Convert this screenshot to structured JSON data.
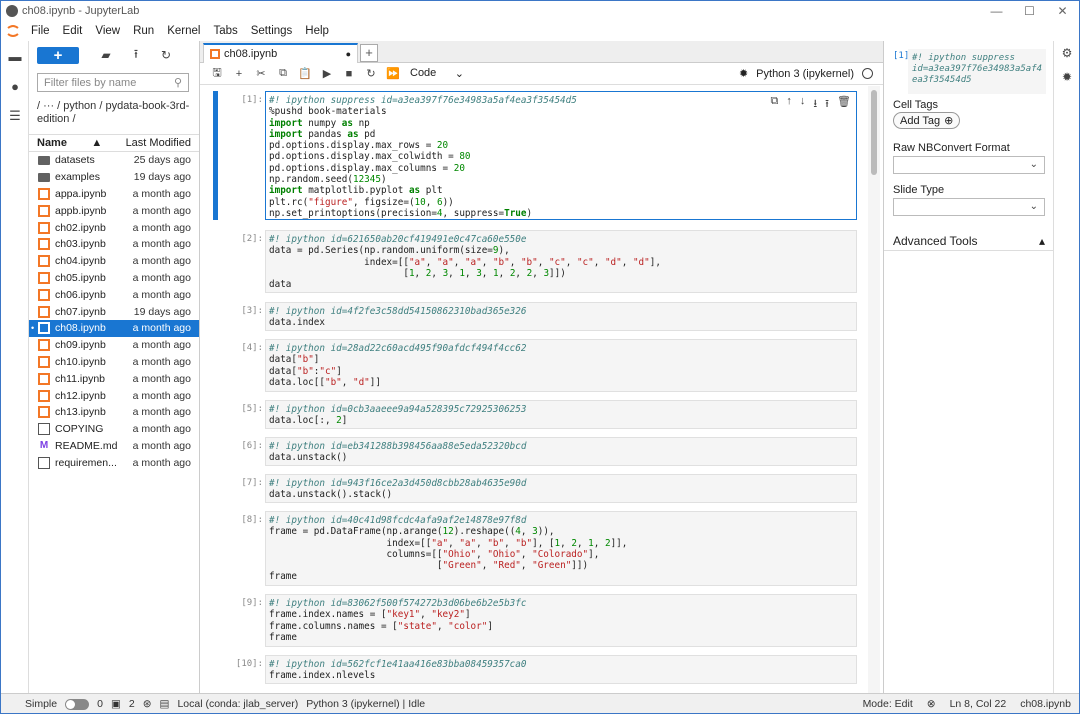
{
  "window": {
    "title": "ch08.ipynb - JupyterLab",
    "minimize": "—",
    "maximize": "☐",
    "close": "✕"
  },
  "menu": [
    "File",
    "Edit",
    "View",
    "Run",
    "Kernel",
    "Tabs",
    "Settings",
    "Help"
  ],
  "filebrowser": {
    "new_label": "+",
    "filter_placeholder": "Filter files by name",
    "breadcrumb_line1": "/ ··· / python / pydata-book-3rd-",
    "breadcrumb_line2": "edition /",
    "header_name": "Name",
    "header_modified": "Last Modified",
    "sort_arrow": "▲",
    "files": [
      {
        "name": "datasets",
        "modified": "25 days ago",
        "kind": "folder"
      },
      {
        "name": "examples",
        "modified": "19 days ago",
        "kind": "folder"
      },
      {
        "name": "appa.ipynb",
        "modified": "a month ago",
        "kind": "notebook"
      },
      {
        "name": "appb.ipynb",
        "modified": "a month ago",
        "kind": "notebook"
      },
      {
        "name": "ch02.ipynb",
        "modified": "a month ago",
        "kind": "notebook"
      },
      {
        "name": "ch03.ipynb",
        "modified": "a month ago",
        "kind": "notebook"
      },
      {
        "name": "ch04.ipynb",
        "modified": "a month ago",
        "kind": "notebook"
      },
      {
        "name": "ch05.ipynb",
        "modified": "a month ago",
        "kind": "notebook"
      },
      {
        "name": "ch06.ipynb",
        "modified": "a month ago",
        "kind": "notebook"
      },
      {
        "name": "ch07.ipynb",
        "modified": "19 days ago",
        "kind": "notebook"
      },
      {
        "name": "ch08.ipynb",
        "modified": "a month ago",
        "kind": "notebook",
        "selected": true
      },
      {
        "name": "ch09.ipynb",
        "modified": "a month ago",
        "kind": "notebook"
      },
      {
        "name": "ch10.ipynb",
        "modified": "a month ago",
        "kind": "notebook"
      },
      {
        "name": "ch11.ipynb",
        "modified": "a month ago",
        "kind": "notebook"
      },
      {
        "name": "ch12.ipynb",
        "modified": "a month ago",
        "kind": "notebook"
      },
      {
        "name": "ch13.ipynb",
        "modified": "a month ago",
        "kind": "notebook"
      },
      {
        "name": "COPYING",
        "modified": "a month ago",
        "kind": "file"
      },
      {
        "name": "README.md",
        "modified": "a month ago",
        "kind": "markdown"
      },
      {
        "name": "requiremen...",
        "modified": "a month ago",
        "kind": "file"
      }
    ]
  },
  "tab": {
    "label": "ch08.ipynb",
    "dirty": "●",
    "add": "+"
  },
  "toolbar": {
    "cell_type": "Code",
    "kernel": "Python 3 (ipykernel)"
  },
  "cells": [
    {
      "prompt": "[1]:",
      "active": true,
      "html": "<span class=\"cmt\">#! ipython suppress id=a3ea397f76e34983a5af4ea3f35454d5</span>\n%pushd book-materials\n<span class=\"kw\">import</span> numpy <span class=\"kw\">as</span> np\n<span class=\"kw\">import</span> pandas <span class=\"kw\">as</span> pd\npd.options.display.max_rows = <span class=\"num\">20</span>\npd.options.display.max_colwidth = <span class=\"num\">80</span>\npd.options.display.max_columns = <span class=\"num\">20</span>\nnp.random.seed(<span class=\"num\">12345</span>)\n<span class=\"kw\">import</span> matplotlib.pyplot <span class=\"kw\">as</span> plt\nplt.rc(<span class=\"str\">\"figure\"</span>, figsize=(<span class=\"num\">10</span>, <span class=\"num\">6</span>))\nnp.set_printoptions(precision=<span class=\"num\">4</span>, suppress=<span class=\"kw\">True</span>)"
    },
    {
      "prompt": "[2]:",
      "html": "<span class=\"cmt\">#! ipython id=621650ab20cf419491e0c47ca60e550e</span>\ndata = pd.Series(np.random.uniform(size=<span class=\"num\">9</span>),\n                 index=[[<span class=\"str\">\"a\"</span>, <span class=\"str\">\"a\"</span>, <span class=\"str\">\"a\"</span>, <span class=\"str\">\"b\"</span>, <span class=\"str\">\"b\"</span>, <span class=\"str\">\"c\"</span>, <span class=\"str\">\"c\"</span>, <span class=\"str\">\"d\"</span>, <span class=\"str\">\"d\"</span>],\n                        [<span class=\"num\">1</span>, <span class=\"num\">2</span>, <span class=\"num\">3</span>, <span class=\"num\">1</span>, <span class=\"num\">3</span>, <span class=\"num\">1</span>, <span class=\"num\">2</span>, <span class=\"num\">2</span>, <span class=\"num\">3</span>]])\ndata"
    },
    {
      "prompt": "[3]:",
      "html": "<span class=\"cmt\">#! ipython id=4f2fe3c58dd54150862310bad365e326</span>\ndata.index"
    },
    {
      "prompt": "[4]:",
      "html": "<span class=\"cmt\">#! ipython id=28ad22c60acd495f90afdcf494f4cc62</span>\ndata[<span class=\"str\">\"b\"</span>]\ndata[<span class=\"str\">\"b\"</span>:<span class=\"str\">\"c\"</span>]\ndata.loc[[<span class=\"str\">\"b\"</span>, <span class=\"str\">\"d\"</span>]]"
    },
    {
      "prompt": "[5]:",
      "html": "<span class=\"cmt\">#! ipython id=0cb3aaeee9a94a528395c72925306253</span>\ndata.loc[:, <span class=\"num\">2</span>]"
    },
    {
      "prompt": "[6]:",
      "html": "<span class=\"cmt\">#! ipython id=eb341288b398456aa88e5eda52320bcd</span>\ndata.unstack()"
    },
    {
      "prompt": "[7]:",
      "html": "<span class=\"cmt\">#! ipython id=943f16ce2a3d450d8cbb28ab4635e90d</span>\ndata.unstack().stack()"
    },
    {
      "prompt": "[8]:",
      "html": "<span class=\"cmt\">#! ipython id=40c41d98fcdc4afa9af2e14878e97f8d</span>\nframe = pd.DataFrame(np.arange(<span class=\"num\">12</span>).reshape((<span class=\"num\">4</span>, <span class=\"num\">3</span>)),\n                     index=[[<span class=\"str\">\"a\"</span>, <span class=\"str\">\"a\"</span>, <span class=\"str\">\"b\"</span>, <span class=\"str\">\"b\"</span>], [<span class=\"num\">1</span>, <span class=\"num\">2</span>, <span class=\"num\">1</span>, <span class=\"num\">2</span>]],\n                     columns=[[<span class=\"str\">\"Ohio\"</span>, <span class=\"str\">\"Ohio\"</span>, <span class=\"str\">\"Colorado\"</span>],\n                              [<span class=\"str\">\"Green\"</span>, <span class=\"str\">\"Red\"</span>, <span class=\"str\">\"Green\"</span>]])\nframe"
    },
    {
      "prompt": "[9]:",
      "html": "<span class=\"cmt\">#! ipython id=83062f500f574272b3d06be6b2e5b3fc</span>\nframe.index.names = [<span class=\"str\">\"key1\"</span>, <span class=\"str\">\"key2\"</span>]\nframe.columns.names = [<span class=\"str\">\"state\"</span>, <span class=\"str\">\"color\"</span>]\nframe"
    },
    {
      "prompt": "[10]:",
      "html": "<span class=\"cmt\">#! ipython id=562fcf1e41aa416e83bba08459357ca0</span>\nframe.index.nlevels"
    }
  ],
  "rightpanel": {
    "prompt": "[1]:",
    "code": "#! ipython suppress\nid=a3ea397f76e34983a5af4\nea3f35454d5",
    "cell_tags": "Cell Tags",
    "add_tag": "Add Tag",
    "raw_format": "Raw NBConvert Format",
    "slide_type": "Slide Type",
    "advanced": "Advanced Tools"
  },
  "status": {
    "mode_label": "Simple",
    "count_a": "0",
    "count_b": "2",
    "env": "Local (conda: jlab_server)",
    "kernel": "Python 3 (ipykernel) | Idle",
    "mode": "Mode: Edit",
    "position": "Ln 8, Col 22",
    "file": "ch08.ipynb"
  }
}
